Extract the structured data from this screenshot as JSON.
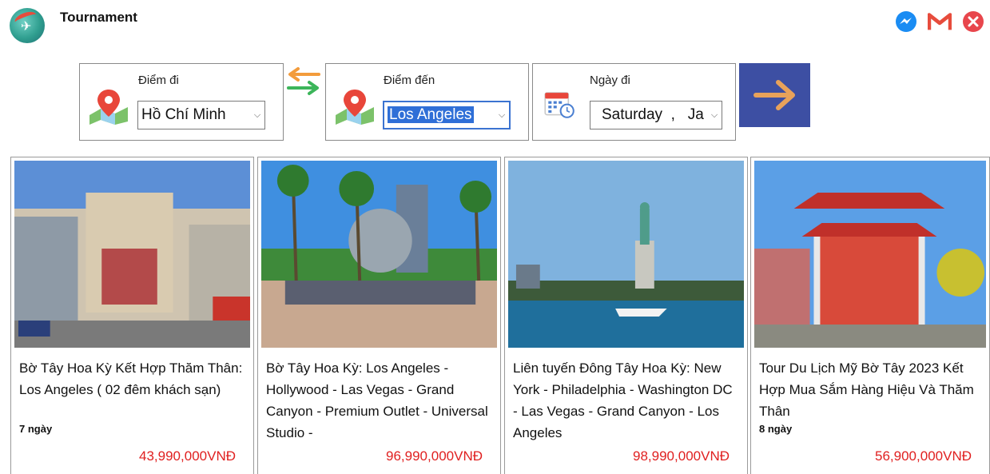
{
  "app": {
    "title": "Tournament"
  },
  "search": {
    "origin": {
      "label": "Điểm đi",
      "value": "Hồ Chí Minh"
    },
    "destination": {
      "label": "Điểm đến",
      "value": "Los Angeles"
    },
    "date": {
      "label": "Ngày đi",
      "value": "Saturday  ,   Ja"
    }
  },
  "colors": {
    "accent": "#3d4fa3",
    "price": "#e02020",
    "arrow": "#e8a25a"
  },
  "tours": [
    {
      "title": "Bờ Tây Hoa Kỳ Kết Hợp Thăm Thân: Los Angeles ( 02 đêm khách sạn)",
      "duration": "7 ngày",
      "price": "43,990,000VNĐ"
    },
    {
      "title": "Bờ Tây Hoa Kỳ: Los Angeles - Hollywood - Las Vegas - Grand Canyon - Premium Outlet - Universal Studio -",
      "duration": "",
      "price": "96,990,000VNĐ"
    },
    {
      "title": "Liên tuyến Đông Tây Hoa Kỳ: New York - Philadelphia - Washington DC - Las Vegas - Grand Canyon - Los Angeles",
      "duration": "",
      "price": "98,990,000VNĐ"
    },
    {
      "title": "Tour Du Lịch Mỹ Bờ Tây 2023 Kết Hợp Mua Sắm Hàng Hiệu Và Thăm Thân",
      "duration": "8 ngày",
      "price": "56,900,000VNĐ"
    }
  ],
  "icons": {
    "messenger": "messenger-icon",
    "gmail": "gmail-icon",
    "close": "close-icon"
  }
}
